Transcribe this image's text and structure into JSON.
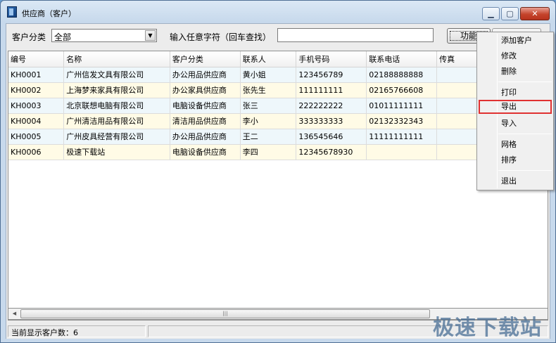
{
  "window": {
    "title": "供应商（客户）"
  },
  "toolbar": {
    "category_label": "客户分类",
    "category_value": "全部",
    "search_label": "输入任意字符（回车查找）",
    "search_value": "",
    "function_button": "功能"
  },
  "table": {
    "columns": [
      "编号",
      "名称",
      "客户分类",
      "联系人",
      "手机号码",
      "联系电话",
      "传真",
      ""
    ],
    "rows": [
      [
        "KH0001",
        "广州信发文具有限公司",
        "办公用品供应商",
        "黄小姐",
        "123456789",
        "02188888888",
        "",
        ""
      ],
      [
        "KH0002",
        "上海梦来家具有限公司",
        "办公家具供应商",
        "张先生",
        "111111111",
        "02165766608",
        "",
        ""
      ],
      [
        "KH0003",
        "北京联想电脑有限公司",
        "电脑设备供应商",
        "张三",
        "222222222",
        "01011111111",
        "",
        ""
      ],
      [
        "KH0004",
        "广州清洁用品有限公司",
        "清洁用品供应商",
        "李小",
        "333333333",
        "02132332343",
        "",
        ""
      ],
      [
        "KH0005",
        "广州皮具经营有限公司",
        "办公用品供应商",
        "王二",
        "136545646",
        "11111111111",
        "",
        ""
      ],
      [
        "KH0006",
        "极速下载站",
        "电脑设备供应商",
        "李四",
        "12345678930",
        "",
        "",
        ""
      ]
    ]
  },
  "status": {
    "count_text": "当前显示客户数：6"
  },
  "context_menu": {
    "items": [
      "添加客户",
      "修改",
      "删除",
      "打印",
      "导出",
      "导入",
      "网格",
      "排序",
      "退出"
    ],
    "highlighted": "导出",
    "highlight_color": "#e03131"
  },
  "watermark": "极速下载站",
  "icons": {
    "minimize": "minimize-icon",
    "maximize": "maximize-icon",
    "close": "close-icon",
    "dropdown": "chevron-down-icon",
    "scroll_left": "arrow-left-icon"
  }
}
